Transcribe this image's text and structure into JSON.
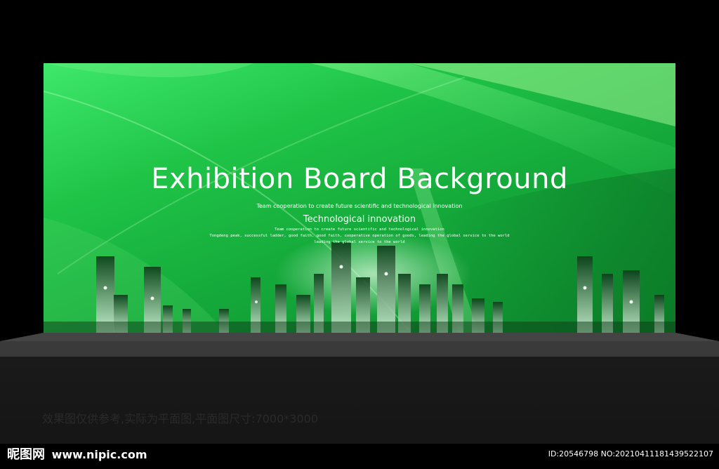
{
  "board": {
    "title": "Exhibition Board Background",
    "tagline": "Team cooperation to create future scientific and technological innovation",
    "subtitle": "Technological innovation",
    "small_lines": [
      "Team cooperation to create future scientific and technological innovation",
      "Tongdeng peak, successful ladder, good faith, good faith, cooperative operation of goods, leading the global service to the world",
      "leading the global service to the world"
    ]
  },
  "caption": "效果图仅供参考,实际为平面图,平面图尺寸:7000*3000",
  "watermark": {
    "brand": "昵图网",
    "url": "www.nipic.com",
    "image_id": "ID:20546798 NO:20210411181439522107"
  },
  "colors": {
    "board_light": "#3ee86a",
    "board_dark": "#0e8a2e",
    "stage_floor": "#3a3a3a",
    "background": "#000000"
  }
}
